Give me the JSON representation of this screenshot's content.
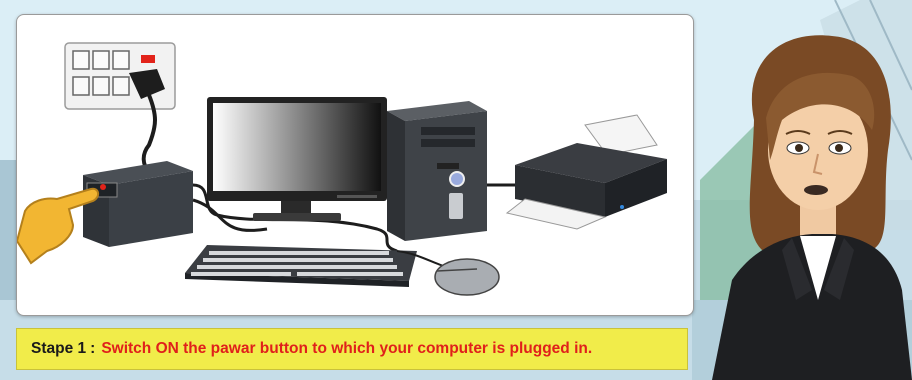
{
  "caption": {
    "step_label": "Stape 1",
    "separator": ":",
    "instruction": "Switch ON the pawar button to which your computer is plugged in."
  },
  "colors": {
    "caption_bg": "#f1ec4a",
    "step_text": "#1a1a1a",
    "instruction_text": "#e0201b",
    "socket_switch_red": "#e2231a"
  },
  "icons": [
    "wall-socket-icon",
    "power-plug-icon",
    "ups-icon",
    "monitor-icon",
    "cpu-tower-icon",
    "printer-icon",
    "keyboard-icon",
    "mouse-icon",
    "pointing-hand-icon",
    "presenter-avatar"
  ]
}
